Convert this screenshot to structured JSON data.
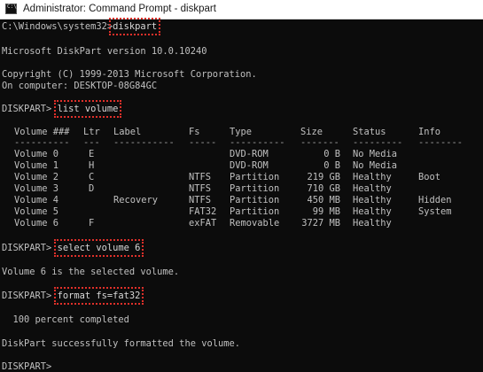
{
  "window": {
    "title": "Administrator: Command Prompt - diskpart"
  },
  "console": {
    "cmd1_prompt": "C:\\Windows\\system32>",
    "cmd1_text": "diskpart",
    "version_line": "Microsoft DiskPart version 10.0.10240",
    "copyright_line": "Copyright (C) 1999-2013 Microsoft Corporation.",
    "computer_line": "On computer: DESKTOP-08G84GC",
    "cmd2_prompt": "DISKPART> ",
    "cmd2_text": "list volume",
    "table": {
      "headers": [
        "Volume ###",
        "Ltr",
        "Label",
        "Fs",
        "Type",
        "Size",
        "Status",
        "Info"
      ],
      "dashes": [
        "----------",
        "---",
        "-----------",
        "-----",
        "----------",
        "-------",
        "---------",
        "--------"
      ],
      "rows": [
        [
          "Volume 0",
          "E",
          "",
          "",
          "DVD-ROM",
          "0 B",
          "No Media",
          ""
        ],
        [
          "Volume 1",
          "H",
          "",
          "",
          "DVD-ROM",
          "0 B",
          "No Media",
          ""
        ],
        [
          "Volume 2",
          "C",
          "",
          "NTFS",
          "Partition",
          "219 GB",
          "Healthy",
          "Boot"
        ],
        [
          "Volume 3",
          "D",
          "",
          "NTFS",
          "Partition",
          "710 GB",
          "Healthy",
          ""
        ],
        [
          "Volume 4",
          "",
          "Recovery",
          "NTFS",
          "Partition",
          "450 MB",
          "Healthy",
          "Hidden"
        ],
        [
          "Volume 5",
          "",
          "",
          "FAT32",
          "Partition",
          "99 MB",
          "Healthy",
          "System"
        ],
        [
          "Volume 6",
          "F",
          "",
          "exFAT",
          "Removable",
          "3727 MB",
          "Healthy",
          ""
        ]
      ]
    },
    "cmd3_prompt": "DISKPART> ",
    "cmd3_text": "select volume 6",
    "select_result": "Volume 6 is the selected volume.",
    "cmd4_prompt": "DISKPART> ",
    "cmd4_text": "format fs=fat32",
    "progress_line": "  100 percent completed",
    "format_result": "DiskPart successfully formatted the volume.",
    "final_prompt": "DISKPART> "
  },
  "colors": {
    "background": "#0c0c0c",
    "text": "#c0c0c0",
    "highlight": "#e0302a"
  }
}
